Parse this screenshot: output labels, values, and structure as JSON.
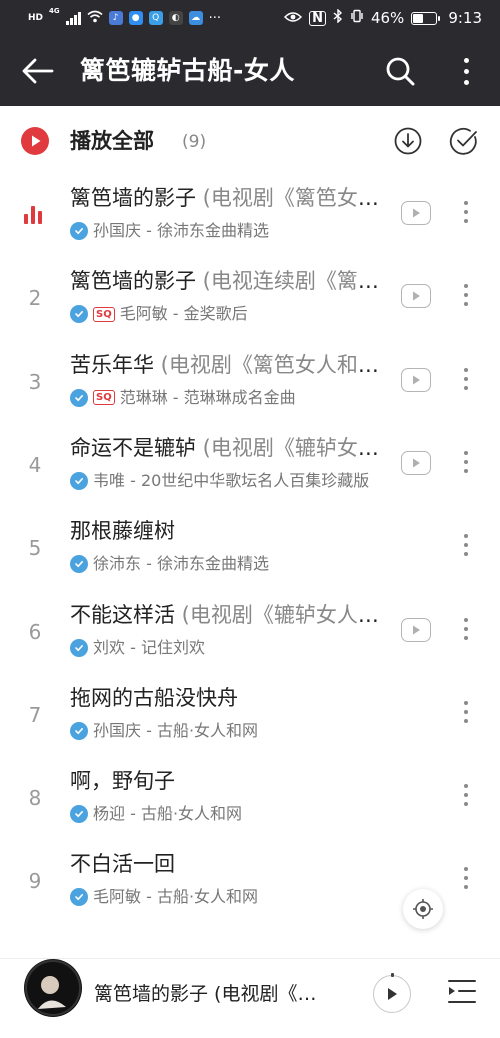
{
  "status_bar": {
    "net_hd": "HD",
    "net_type": "4G",
    "battery": "46%",
    "time": "9:13",
    "more": "···"
  },
  "header": {
    "title": "篱笆辘轳古船-女人"
  },
  "play_all": {
    "label": "播放全部",
    "count": "(9)"
  },
  "songs": [
    {
      "index": "",
      "playing": true,
      "title": "篱笆墙的影子",
      "subtitle": " (电视剧《篱笆女人和狗》主题曲)",
      "sq": false,
      "meta": "孙国庆 - 徐沛东金曲精选",
      "mv": true
    },
    {
      "index": "2",
      "playing": false,
      "title": "篱笆墙的影子",
      "subtitle": " (电视连续剧《篱笆女人和狗》主题曲)",
      "sq": true,
      "sq_label": "SQ",
      "meta": "毛阿敏 - 金奖歌后",
      "mv": true
    },
    {
      "index": "3",
      "playing": false,
      "title": "苦乐年华",
      "subtitle": " (电视剧《篱笆女人和狗》插曲)",
      "sq": true,
      "sq_label": "SQ",
      "meta": "范琳琳 - 范琳琳成名金曲",
      "mv": true
    },
    {
      "index": "4",
      "playing": false,
      "title": "命运不是辘轳",
      "subtitle": " (电视剧《辘轳女人和井》主题曲)",
      "sq": false,
      "meta": "韦唯 - 20世纪中华歌坛名人百集珍藏版",
      "mv": true
    },
    {
      "index": "5",
      "playing": false,
      "title": "那根藤缠树",
      "subtitle": "",
      "sq": false,
      "meta": "徐沛东 - 徐沛东金曲精选",
      "mv": false
    },
    {
      "index": "6",
      "playing": false,
      "title": "不能这样活",
      "subtitle": " (电视剧《辘轳女人和井》主题曲)",
      "sq": false,
      "meta": "刘欢 - 记住刘欢",
      "mv": true
    },
    {
      "index": "7",
      "playing": false,
      "title": "拖网的古船没快舟",
      "subtitle": "",
      "sq": false,
      "meta": "孙国庆 - 古船·女人和网",
      "mv": false
    },
    {
      "index": "8",
      "playing": false,
      "title": "啊，野旬子",
      "subtitle": "",
      "sq": false,
      "meta": "杨迎 - 古船·女人和网",
      "mv": false
    },
    {
      "index": "9",
      "playing": false,
      "title": "不白活一回",
      "subtitle": "",
      "sq": false,
      "meta": "毛阿敏 - 古船·女人和网",
      "mv": false
    }
  ],
  "player": {
    "title": "篱笆墙的影子 (电视剧《篱笆女人和狗》主题曲)"
  },
  "colors": {
    "header_bg": "#2b2a2f",
    "accent_red": "#e0393e",
    "verified_blue": "#4aa3df"
  }
}
